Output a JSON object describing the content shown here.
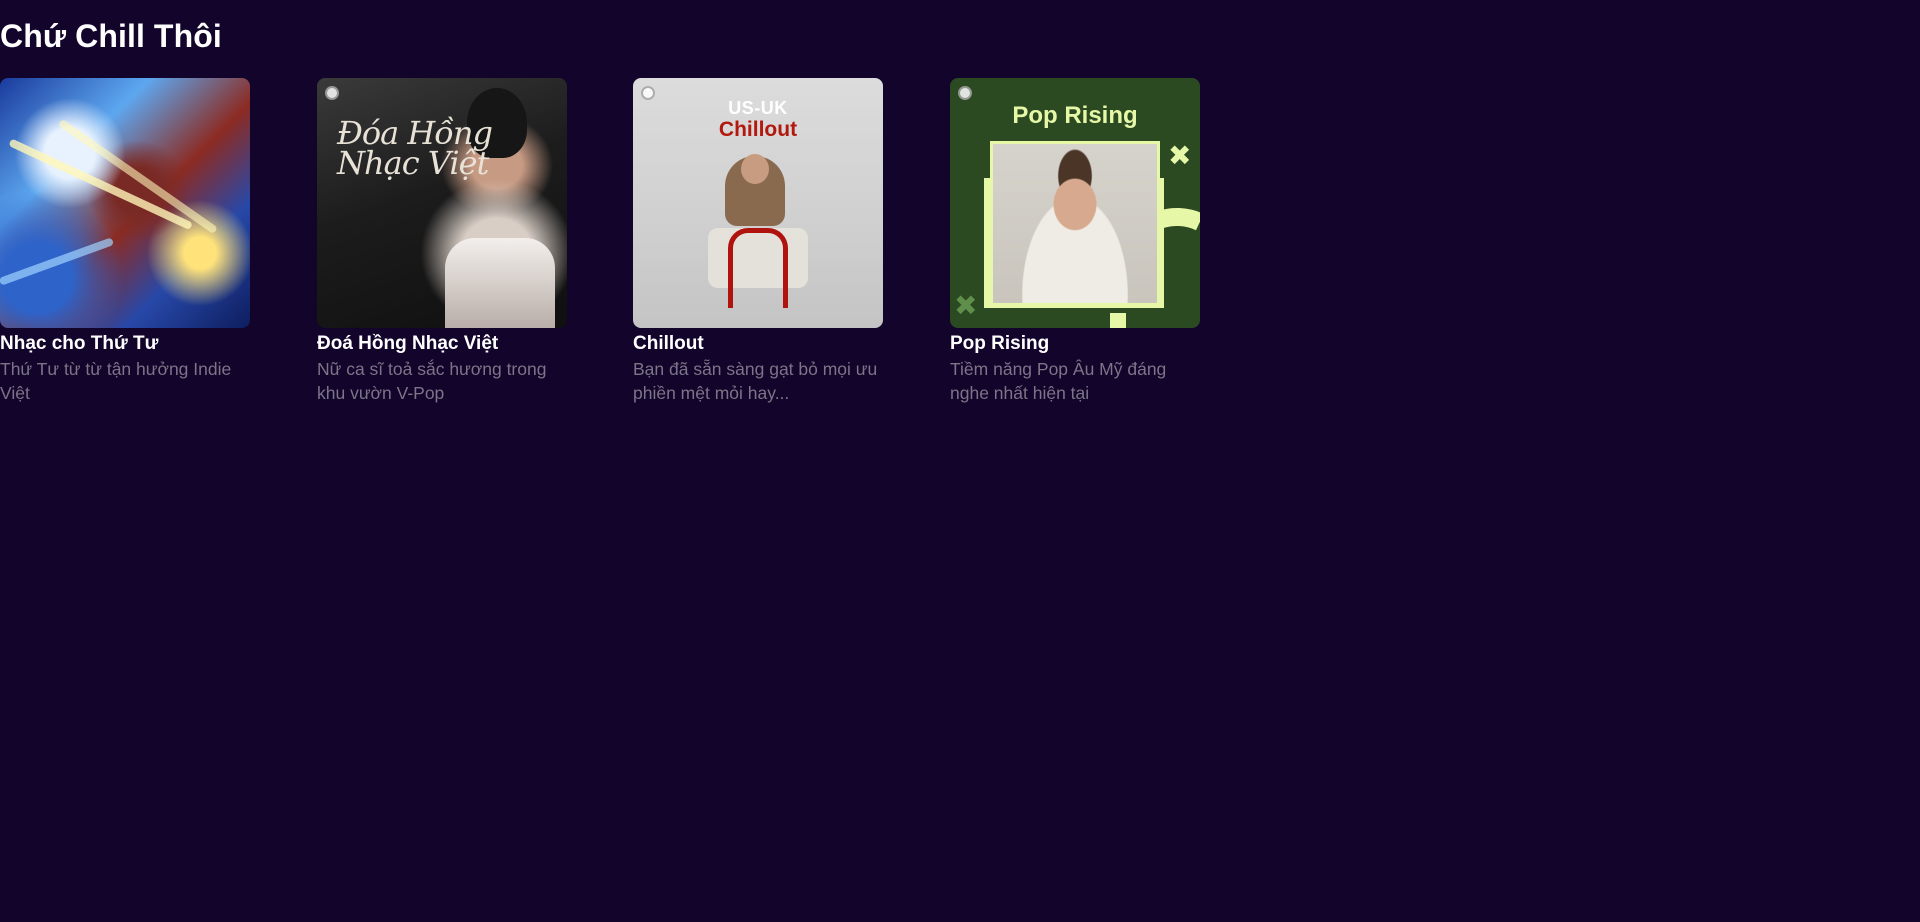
{
  "section": {
    "title": "Chứ Chill Thôi"
  },
  "cards": [
    {
      "title": "Nhạc cho Thứ Tư",
      "description": "Thứ Tư từ từ tận hưởng Indie Việt"
    },
    {
      "title": "Đoá Hồng Nhạc Việt",
      "description": "Nữ ca sĩ toả sắc hương trong khu vườn V-Pop",
      "cover_text": "Đóa Hồng Nhạc Việt"
    },
    {
      "title": "Chillout",
      "description": "Bạn đã sẵn sàng gạt bỏ mọi ưu phiền mệt mỏi hay...",
      "cover_text_top": "US-UK",
      "cover_text_main": "Chillout"
    },
    {
      "title": "Pop Rising",
      "description": "Tiềm năng Pop Âu Mỹ đáng nghe nhất hiện tại",
      "cover_text": "Pop Rising"
    }
  ],
  "colors": {
    "background": "#12042b",
    "title_text": "#ffffff",
    "description_text": "#7c7487",
    "pop_rising_accent": "#e6f7a8",
    "pop_rising_bg": "#2b4a22",
    "chillout_red": "#b3180e"
  },
  "icons": {
    "cover_badge": "spotify-logo-icon",
    "pop_rising_decor": "x-mark-icon"
  }
}
